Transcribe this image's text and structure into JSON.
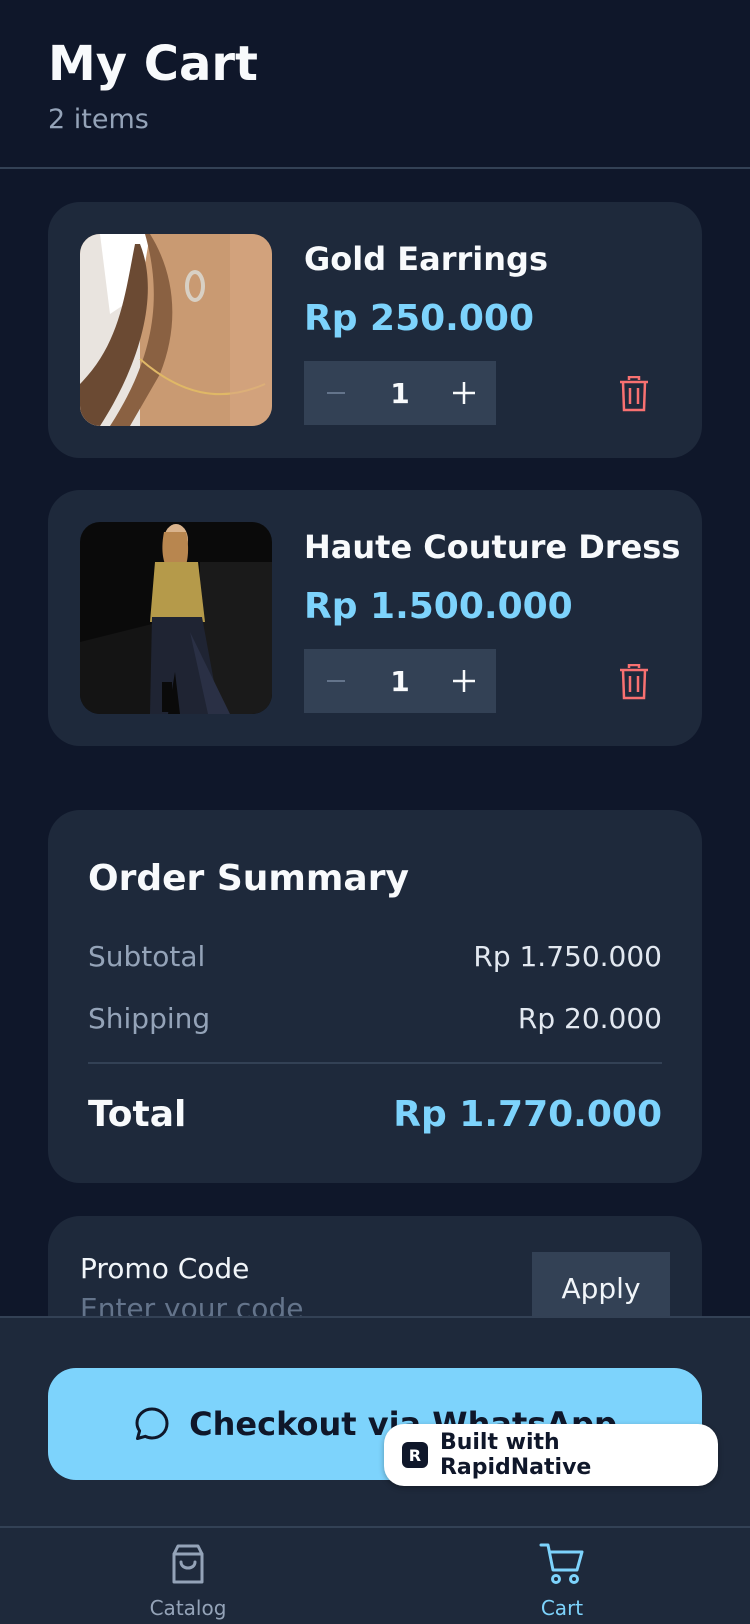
{
  "header": {
    "title": "My Cart",
    "subtitle": "2 items"
  },
  "cart_items": [
    {
      "name": "Gold Earrings",
      "price": "Rp 250.000",
      "quantity": "1",
      "image": "gold-earrings-photo"
    },
    {
      "name": "Haute Couture Dress",
      "price": "Rp 1.500.000",
      "quantity": "1",
      "image": "haute-couture-dress-photo"
    }
  ],
  "summary": {
    "title": "Order Summary",
    "subtotal_label": "Subtotal",
    "subtotal_value": "Rp 1.750.000",
    "shipping_label": "Shipping",
    "shipping_value": "Rp 20.000",
    "total_label": "Total",
    "total_value": "Rp 1.770.000"
  },
  "promo": {
    "label": "Promo Code",
    "placeholder": "Enter your code",
    "apply_label": "Apply"
  },
  "checkout": {
    "label": "Checkout via WhatsApp",
    "icon": "chat-bubble-icon"
  },
  "badge": {
    "label": "Built with RapidNative",
    "logo": "rapidnative-logo"
  },
  "tabs": [
    {
      "label": "Catalog",
      "icon": "shopping-bag-icon",
      "active": false
    },
    {
      "label": "Cart",
      "icon": "cart-icon",
      "active": true
    }
  ],
  "colors": {
    "background": "#0f172a",
    "card": "#1e293b",
    "accent": "#7dd3fc",
    "danger": "#f87171",
    "muted": "#94a3b8"
  }
}
